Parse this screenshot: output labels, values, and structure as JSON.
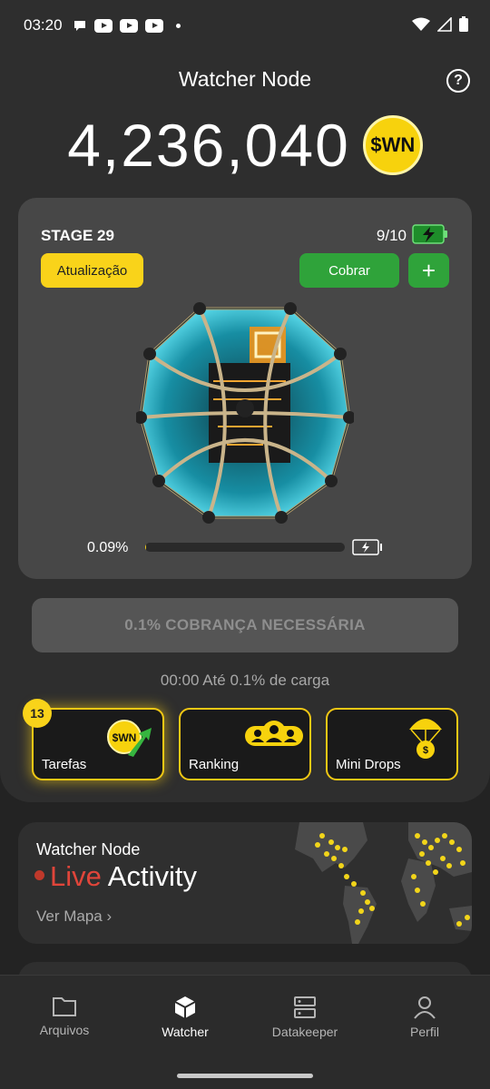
{
  "status_bar": {
    "time": "03:20"
  },
  "header": {
    "title": "Watcher Node",
    "help_icon": "help-circle-icon"
  },
  "balance": {
    "amount": "4,236,040",
    "token": "$WN"
  },
  "stage_card": {
    "stage_label": "STAGE 29",
    "energy": "9/10",
    "update_label": "Atualização",
    "collect_label": "Cobrar",
    "add_label": "+",
    "progress_label": "0.09%",
    "progress_fraction": 0.0009
  },
  "charge": {
    "button_label": "0.1% COBRANÇA NECESSÁRIA",
    "info": "00:00 Até 0.1% de carga"
  },
  "tiles": [
    {
      "label": "Tarefas",
      "badge": "13",
      "icon": "wn-coin-arrow-icon"
    },
    {
      "label": "Ranking",
      "icon": "users-icon"
    },
    {
      "label": "Mini Drops",
      "icon": "parachute-coin-icon"
    }
  ],
  "live": {
    "subtitle": "Watcher Node",
    "live_word": "Live",
    "activity_word": "Activity",
    "link": "Ver Mapa"
  },
  "nav": [
    {
      "label": "Arquivos",
      "icon": "folder-icon"
    },
    {
      "label": "Watcher",
      "icon": "cube-icon",
      "active": true
    },
    {
      "label": "Datakeeper",
      "icon": "server-icon"
    },
    {
      "label": "Perfil",
      "icon": "person-icon"
    }
  ],
  "colors": {
    "accent": "#f9d31a",
    "green": "#2fa33a",
    "live_red": "#e0453a"
  }
}
